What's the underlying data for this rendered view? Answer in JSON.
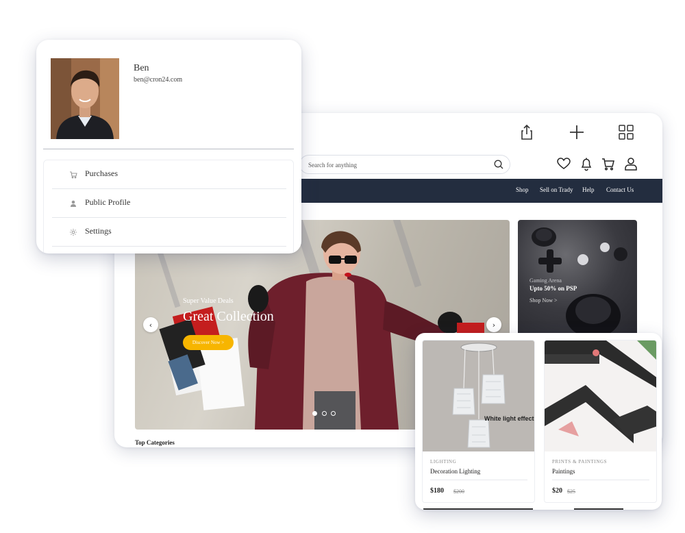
{
  "toolbar": {
    "icons": [
      "share-icon",
      "plus-icon",
      "grid-icon"
    ]
  },
  "header": {
    "search": {
      "placeholder": "Search for anything",
      "value": ""
    },
    "user_icons": [
      "heart-icon",
      "bell-icon",
      "cart-icon",
      "user-icon"
    ]
  },
  "nav": {
    "links": [
      "Shop",
      "Sell on Trady",
      "Help",
      "Contact Us"
    ]
  },
  "hero": {
    "subtitle": "Super Value Deals",
    "title": "Great Collection",
    "cta": "Discover Now >",
    "prev": "‹",
    "next": "›",
    "slides": 3,
    "active_slide": 1
  },
  "promo": {
    "subtitle": "Gaming Arena",
    "title": "Upto 50% on PSP",
    "link": "Shop Now >"
  },
  "sections": {
    "top_categories": "Top Categories"
  },
  "profile": {
    "name": "Ben",
    "email": "ben@cron24.com",
    "menu": [
      {
        "label": "Purchases",
        "icon": "cart-icon"
      },
      {
        "label": "Public Profile",
        "icon": "person-icon"
      },
      {
        "label": "Settings",
        "icon": "gear-icon"
      }
    ]
  },
  "products": [
    {
      "category": "LIGHTING",
      "name": "Decoration Lighting",
      "price": "$180",
      "old_price": "$200",
      "image_caption": "White light effect"
    },
    {
      "category": "PRINTS & PAINTINGS",
      "name": "Paintings",
      "price": "$20",
      "old_price": "$25"
    }
  ],
  "colors": {
    "nav_bg": "#232d3f",
    "cta": "#f7b500",
    "coat": "#6e1f2c"
  }
}
